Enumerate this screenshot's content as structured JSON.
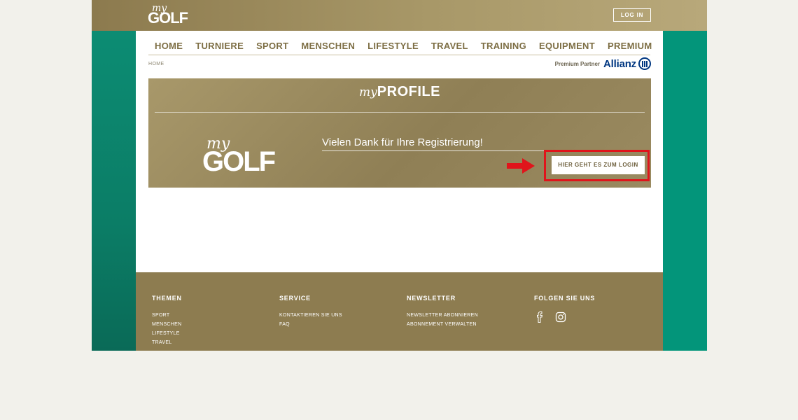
{
  "header": {
    "logo_my": "my",
    "logo_golf": "GOLF",
    "login_label": "LOG IN"
  },
  "nav": {
    "items": [
      "HOME",
      "TURNIERE",
      "SPORT",
      "MENSCHEN",
      "LIFESTYLE",
      "TRAVEL",
      "TRAINING",
      "EQUIPMENT",
      "PREMIUM"
    ]
  },
  "breadcrumb": "HOME",
  "partner": {
    "label": "Premium Partner",
    "brand": "Allianz"
  },
  "panel": {
    "title_my": "my",
    "title_profile": "PROFILE",
    "logo_my": "my",
    "logo_golf": "GOLF",
    "message": "Vielen Dank für Ihre Registrierung!",
    "cta_label": "HIER GEHT ES ZUM LOGIN"
  },
  "footer": {
    "columns": [
      {
        "title": "THEMEN",
        "links": [
          "SPORT",
          "MENSCHEN",
          "LIFESTYLE",
          "TRAVEL"
        ]
      },
      {
        "title": "SERVICE",
        "links": [
          "KONTAKTIEREN SIE UNS",
          "FAQ"
        ]
      },
      {
        "title": "NEWSLETTER",
        "links": [
          "NEWSLETTER ABONNIEREN",
          "ABONNEMENT VERWALTEN"
        ]
      },
      {
        "title": "FOLGEN SIE UNS",
        "icons": [
          "facebook-icon",
          "instagram-icon"
        ]
      }
    ]
  },
  "colors": {
    "gold": "#8d7c50",
    "teal": "#03957a",
    "nav_text": "#7d6e44",
    "highlight_red": "#e0141b",
    "allianz_blue": "#003781"
  }
}
